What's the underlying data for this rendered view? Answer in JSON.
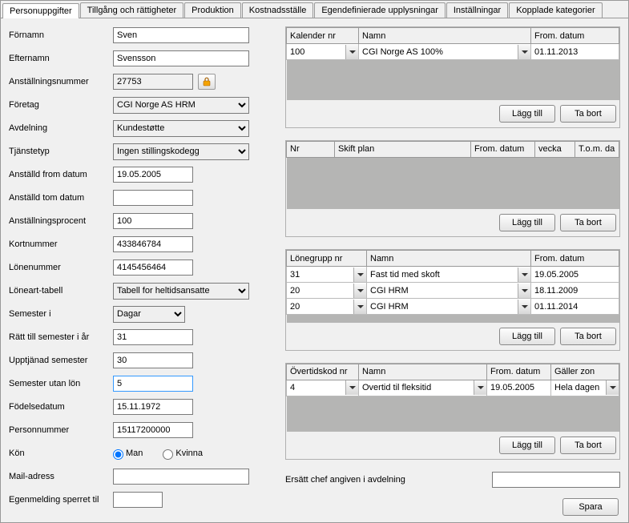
{
  "tabs": [
    "Personuppgifter",
    "Tillgång och rättigheter",
    "Produktion",
    "Kostnadsställe",
    "Egendefinierade upplysningar",
    "Inställningar",
    "Kopplade kategorier"
  ],
  "labels": {
    "fornamn": "Förnamn",
    "efternamn": "Efternamn",
    "anstallningsnummer": "Anställningsnummer",
    "foretag": "Företag",
    "avdelning": "Avdelning",
    "tjanstetyp": "Tjänstetyp",
    "anstalldFrom": "Anställd from datum",
    "anstalldTom": "Anställd tom datum",
    "anstallningsprocent": "Anställningsprocent",
    "kortnummer": "Kortnummer",
    "lonenummer": "Lönenummer",
    "loneartTabell": "Löneart-tabell",
    "semesterI": "Semester i",
    "rattTillSemester": "Rätt till semester i år",
    "upptjanadSemester": "Upptjänad semester",
    "semesterUtanLon": "Semester utan lön",
    "fodelsedatum": "Födelsedatum",
    "personnummer": "Personnummer",
    "kon": "Kön",
    "mailAdress": "Mail-adress",
    "egenmelding": "Egenmelding sperret til",
    "man": "Man",
    "kvinna": "Kvinna",
    "ersattChef": "Ersätt chef angiven i avdelning"
  },
  "values": {
    "fornamn": "Sven",
    "efternamn": "Svensson",
    "anstallningsnummer": "27753",
    "foretag": "CGI Norge AS HRM",
    "avdelning": "Kundestøtte",
    "tjanstetyp": "Ingen stillingskodegg",
    "anstalldFrom": "19.05.2005",
    "anstalldTom": "",
    "anstallningsprocent": "100",
    "kortnummer": "433846784",
    "lonenummer": "4145456464",
    "loneartTabell": "Tabell for heltidsansatte",
    "semesterI": "Dagar",
    "rattTillSemester": "31",
    "upptjanadSemester": "30",
    "semesterUtanLon": "5",
    "fodelsedatum": "15.11.1972",
    "personnummer": "15117200000",
    "kon": "Man",
    "mailAdress": "",
    "egenmelding": "",
    "ersattChef": ""
  },
  "buttons": {
    "laggTill": "Lägg till",
    "taBort": "Ta bort",
    "spara": "Spara"
  },
  "grids": {
    "kalender": {
      "headers": [
        "Kalender nr",
        "Namn",
        "From. datum"
      ],
      "rows": [
        {
          "nr": "100",
          "namn": "CGI Norge AS 100%",
          "from": "01.11.2013"
        }
      ]
    },
    "skift": {
      "headers": [
        "Nr",
        "Skift plan",
        "From. datum",
        "vecka",
        "T.o.m. da"
      ]
    },
    "lonegrupp": {
      "headers": [
        "Lönegrupp nr",
        "Namn",
        "From. datum"
      ],
      "rows": [
        {
          "nr": "31",
          "namn": "Fast tid med skoft",
          "from": "19.05.2005"
        },
        {
          "nr": "20",
          "namn": "CGI HRM",
          "from": "18.11.2009"
        },
        {
          "nr": "20",
          "namn": "CGI HRM",
          "from": "01.11.2014"
        }
      ]
    },
    "overtid": {
      "headers": [
        "Övertidskod nr",
        "Namn",
        "From. datum",
        "Gäller zon"
      ],
      "rows": [
        {
          "nr": "4",
          "namn": "Overtid til fleksitid",
          "from": "19.05.2005",
          "zon": "Hela dagen"
        }
      ]
    }
  }
}
